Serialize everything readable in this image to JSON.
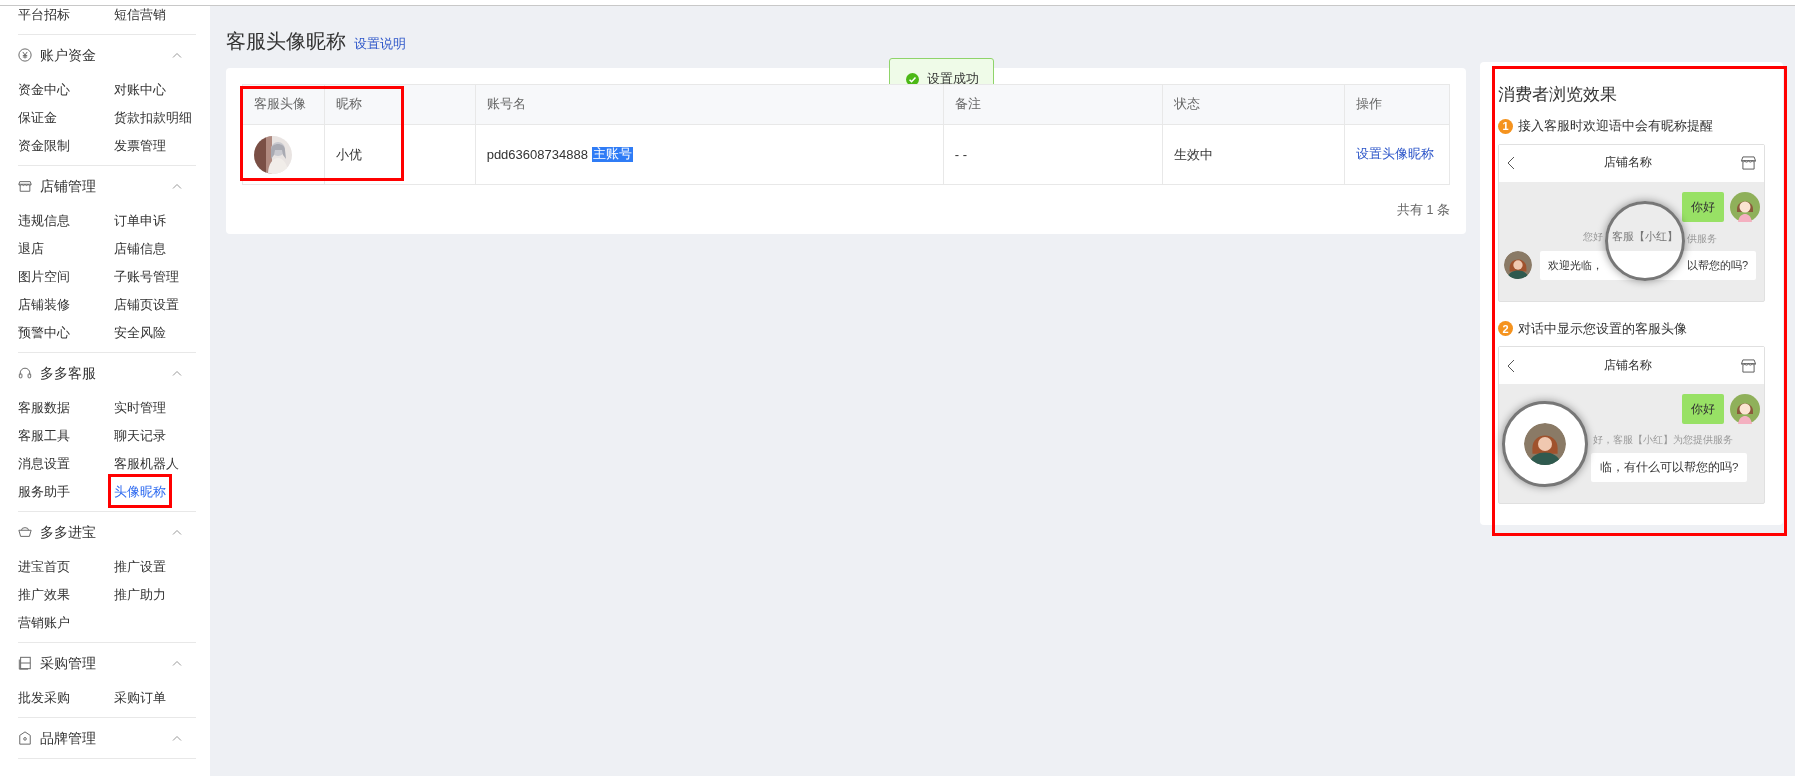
{
  "sidebar": {
    "sections": [
      {
        "items": [
          {
            "label": "平台招标",
            "selected": false,
            "annotated": false
          },
          {
            "label": "短信营销",
            "selected": false,
            "annotated": false
          }
        ]
      },
      {
        "title": "账户资金",
        "kind": "yen",
        "expanded": true,
        "items": [
          {
            "label": "资金中心",
            "selected": false,
            "annotated": false
          },
          {
            "label": "对账中心",
            "selected": false,
            "annotated": false
          },
          {
            "label": "保证金",
            "selected": false,
            "annotated": false
          },
          {
            "label": "货款扣款明细",
            "selected": false,
            "annotated": false
          },
          {
            "label": "资金限制",
            "selected": false,
            "annotated": false
          },
          {
            "label": "发票管理",
            "selected": false,
            "annotated": false
          }
        ]
      },
      {
        "title": "店铺管理",
        "kind": "shop",
        "expanded": true,
        "items": [
          {
            "label": "违规信息",
            "selected": false,
            "annotated": false
          },
          {
            "label": "订单申诉",
            "selected": false,
            "annotated": false
          },
          {
            "label": "退店",
            "selected": false,
            "annotated": false
          },
          {
            "label": "店铺信息",
            "selected": false,
            "annotated": false
          },
          {
            "label": "图片空间",
            "selected": false,
            "annotated": false
          },
          {
            "label": "子账号管理",
            "selected": false,
            "annotated": false
          },
          {
            "label": "店铺装修",
            "selected": false,
            "annotated": false
          },
          {
            "label": "店铺页设置",
            "selected": false,
            "annotated": false
          },
          {
            "label": "预警中心",
            "selected": false,
            "annotated": false
          },
          {
            "label": "安全风险",
            "selected": false,
            "annotated": false
          }
        ]
      },
      {
        "title": "多多客服",
        "kind": "headset",
        "expanded": true,
        "items": [
          {
            "label": "客服数据",
            "selected": false,
            "annotated": false
          },
          {
            "label": "实时管理",
            "selected": false,
            "annotated": false
          },
          {
            "label": "客服工具",
            "selected": false,
            "annotated": false
          },
          {
            "label": "聊天记录",
            "selected": false,
            "annotated": false
          },
          {
            "label": "消息设置",
            "selected": false,
            "annotated": false
          },
          {
            "label": "客服机器人",
            "selected": false,
            "annotated": false
          },
          {
            "label": "服务助手",
            "selected": false,
            "annotated": false
          },
          {
            "label": "头像昵称",
            "selected": true,
            "annotated": true
          }
        ]
      },
      {
        "title": "多多进宝",
        "kind": "ingot",
        "expanded": true,
        "items": [
          {
            "label": "进宝首页",
            "selected": false,
            "annotated": false
          },
          {
            "label": "推广设置",
            "selected": false,
            "annotated": false
          },
          {
            "label": "推广效果",
            "selected": false,
            "annotated": false
          },
          {
            "label": "推广助力",
            "selected": false,
            "annotated": false
          },
          {
            "label": "营销账户",
            "selected": false,
            "annotated": false
          }
        ]
      },
      {
        "title": "采购管理",
        "kind": "list",
        "expanded": true,
        "items": [
          {
            "label": "批发采购",
            "selected": false,
            "annotated": false
          },
          {
            "label": "采购订单",
            "selected": false,
            "annotated": false
          }
        ]
      },
      {
        "title": "品牌管理",
        "kind": "badge",
        "expanded": true
      }
    ]
  },
  "page": {
    "title": "客服头像昵称",
    "help_link": "设置说明"
  },
  "toast": {
    "kind": "success",
    "text": "设置成功"
  },
  "table": {
    "annotated": true,
    "columns": [
      "客服头像",
      "昵称",
      "账号名",
      "备注",
      "状态",
      "操作"
    ],
    "rows": [
      {
        "nickname": "小优",
        "account": "pdd63608734888",
        "account_tag": "主账号",
        "remark": "- -",
        "status": "生效中",
        "action": "设置头像昵称"
      }
    ],
    "total": "共有 1 条"
  },
  "preview": {
    "title": "消费者浏览效果",
    "annotated": true,
    "steps": [
      {
        "number": "1",
        "text": "接入客服时欢迎语中会有昵称提醒",
        "kind": "nickname",
        "shop_name": "店铺名称",
        "customer_message": "你好",
        "notice_parts": [
          "您好",
          "客服【小红】",
          "供服务"
        ],
        "reply_parts": [
          "欢迎光临，",
          "以帮您的吗?"
        ]
      },
      {
        "number": "2",
        "text": "对话中显示您设置的客服头像",
        "kind": "avatar",
        "shop_name": "店铺名称",
        "customer_message": "你好",
        "notice_parts": [
          "好，客服【小红】为您提供服务"
        ],
        "reply_parts": [
          "临，有什么可以帮您的吗?"
        ]
      }
    ]
  }
}
